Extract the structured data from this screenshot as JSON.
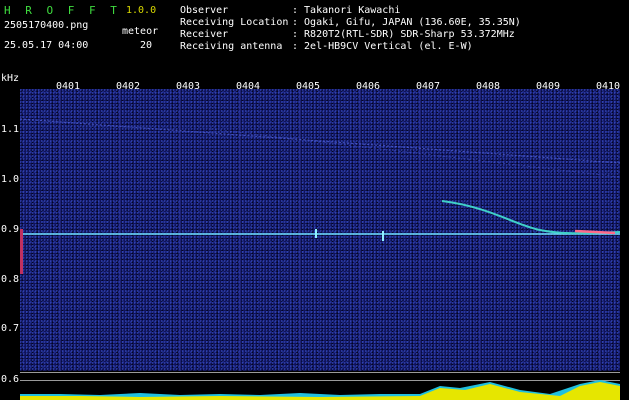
{
  "header": {
    "brand": "H R O F F T",
    "version": "1.0.0",
    "filename": "2505170400.png",
    "datetime": "25.05.17 04:00",
    "meteor_label": "meteor",
    "meteor_count": "20",
    "fields": [
      {
        "label": "Observer",
        "value": ": Takanori Kawachi"
      },
      {
        "label": "Receiving Location",
        "value": ": Ogaki, Gifu, JAPAN (136.60E, 35.35N)"
      },
      {
        "label": "Receiver",
        "value": ": R820T2(RTL-SDR) SDR-Sharp 53.372MHz"
      },
      {
        "label": "Receiving antenna",
        "value": ": 2el-HB9CV Vertical (el. E-W)"
      }
    ]
  },
  "time_axis": {
    "labels": [
      "0401",
      "0402",
      "0403",
      "0404",
      "0405",
      "0406",
      "0407",
      "0408",
      "0409",
      "0410"
    ]
  },
  "freq_axis": {
    "unit": "kHz",
    "labels": [
      "1.1",
      "1.0",
      "0.9",
      "0.8",
      "0.7",
      "0.6"
    ]
  },
  "colors": {
    "background": "#10145a",
    "carrier": "#6fe0ff",
    "echo": "#40d0c8",
    "strip": "#e6e600",
    "strip_alt": "#20c0e0"
  }
}
